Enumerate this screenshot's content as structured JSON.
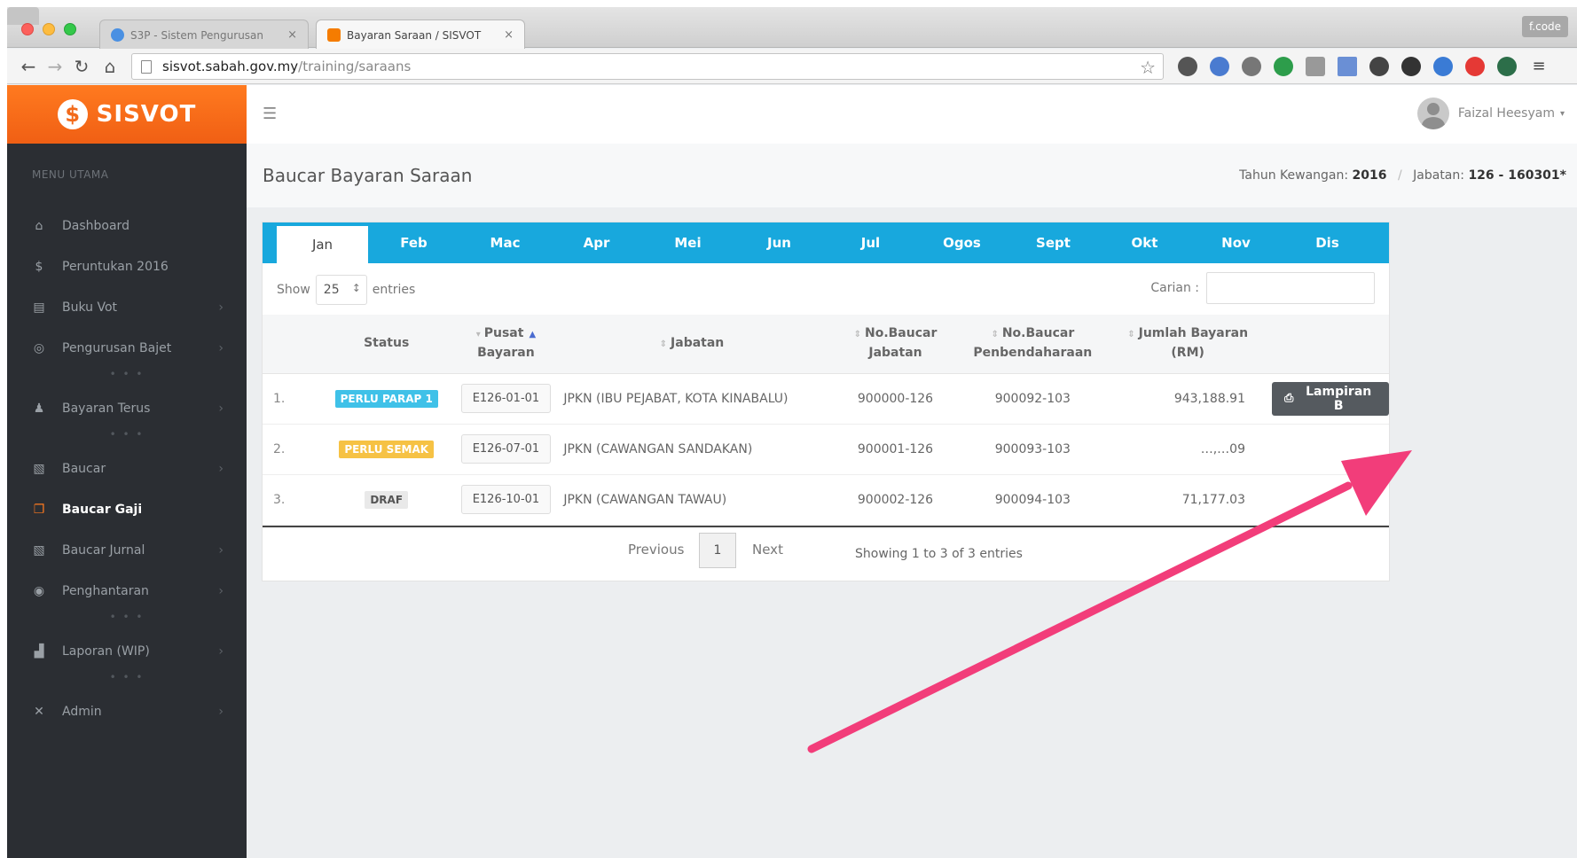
{
  "browser": {
    "tabs": [
      {
        "title": "S3P - Sistem Pengurusan",
        "close": "×"
      },
      {
        "title": "Bayaran Saraan / SISVOT",
        "close": "×"
      }
    ],
    "profile_chip": "f.code",
    "address": {
      "host": "sisvot.sabah.gov.my",
      "path": "/training/saraans"
    }
  },
  "brand": {
    "logo_letter": "$",
    "name": "SISVOT"
  },
  "sidebar": {
    "heading": "MENU UTAMA",
    "items": [
      {
        "label": "Dashboard",
        "icon": "home-icon",
        "glyph": "⌂"
      },
      {
        "label": "Peruntukan 2016",
        "icon": "dollar-icon",
        "glyph": "$"
      },
      {
        "label": "Buku Vot",
        "icon": "book-icon",
        "glyph": "▤",
        "chevron": "›"
      },
      {
        "label": "Pengurusan Bajet",
        "icon": "budget-icon",
        "glyph": "◎",
        "chevron": "›"
      },
      {
        "label": "Bayaran Terus",
        "icon": "user-icon",
        "glyph": "♟",
        "chevron": "›"
      },
      {
        "label": "Baucar",
        "icon": "document-icon",
        "glyph": "▧",
        "chevron": "›"
      },
      {
        "label": "Baucar Gaji",
        "icon": "copy-icon",
        "glyph": "❐"
      },
      {
        "label": "Baucar Jurnal",
        "icon": "journal-icon",
        "glyph": "▧",
        "chevron": "›"
      },
      {
        "label": "Penghantaran",
        "icon": "eye-icon",
        "glyph": "◉",
        "chevron": "›"
      },
      {
        "label": "Laporan (WIP)",
        "icon": "chart-icon",
        "glyph": "▟",
        "chevron": "›"
      },
      {
        "label": "Admin",
        "icon": "tools-icon",
        "glyph": "✕",
        "chevron": "›"
      }
    ],
    "separator": "• • •"
  },
  "header": {
    "user_name": "Faizal Heesyam"
  },
  "page": {
    "title": "Baucar Bayaran Saraan",
    "meta_label_year": "Tahun Kewangan:",
    "meta_year": "2016",
    "meta_sep": "/",
    "meta_label_dept": "Jabatan:",
    "meta_dept": "126 - 160301*"
  },
  "months": [
    "Jan",
    "Feb",
    "Mac",
    "Apr",
    "Mei",
    "Jun",
    "Jul",
    "Ogos",
    "Sept",
    "Okt",
    "Nov",
    "Dis"
  ],
  "controls": {
    "show": "Show",
    "entries_value": "25",
    "entries": "entries",
    "search_label": "Carian :"
  },
  "table": {
    "headers": {
      "status": "Status",
      "pusat_1": "Pusat",
      "pusat_2": "Bayaran",
      "jabatan": "Jabatan",
      "nobj_1": "No.Baucar",
      "nobj_2": "Jabatan",
      "nobp_1": "No.Baucar",
      "nobp_2": "Penbendaharaan",
      "jumlah_1": "Jumlah Bayaran",
      "jumlah_2": "(RM)"
    },
    "rows": [
      {
        "num": "1.",
        "status": "PERLU PARAP 1",
        "status_color": "#3fc1e8",
        "pusat": "E126-01-01",
        "jabatan": "JPKN (IBU PEJABAT, KOTA KINABALU)",
        "no_jabatan": "900000-126",
        "no_bendahari": "900092-103",
        "jumlah": "943,188.91",
        "action": "Lampiran B"
      },
      {
        "num": "2.",
        "status": "PERLU SEMAK",
        "status_color": "#f6c244",
        "pusat": "E126-07-01",
        "jabatan": "JPKN (CAWANGAN SANDAKAN)",
        "no_jabatan": "900001-126",
        "no_bendahari": "900093-103",
        "jumlah": "…,…09"
      },
      {
        "num": "3.",
        "status": "DRAF",
        "status_color": "#e9e9e9",
        "pusat": "E126-10-01",
        "jabatan": "JPKN (CAWANGAN TAWAU)",
        "no_jabatan": "900002-126",
        "no_bendahari": "900094-103",
        "jumlah": "71,177.03"
      }
    ]
  },
  "pager": {
    "previous": "Previous",
    "page": "1",
    "next": "Next",
    "info": "Showing 1 to 3 of 3 entries"
  },
  "colors": {
    "brand": "#f26a1b",
    "tab_bar": "#18a8dd",
    "sidebar": "#2b2e33",
    "arrow": "#f23d7a"
  }
}
